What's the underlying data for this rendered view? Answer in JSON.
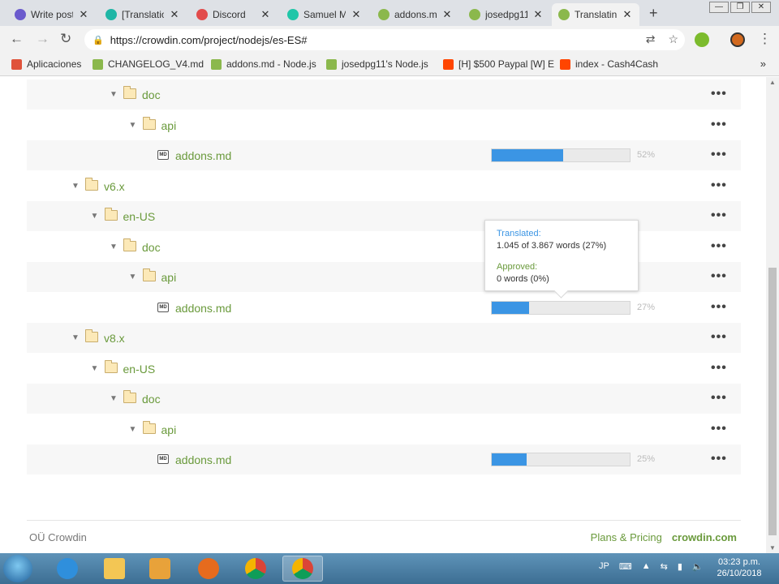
{
  "browser": {
    "tabs": [
      {
        "title": "Write post",
        "color": "#6a5acd"
      },
      {
        "title": "[Translatio",
        "color": "#1fb6a6"
      },
      {
        "title": "Discord",
        "color": "#e24b4b"
      },
      {
        "title": "Samuel M",
        "color": "#1fc6a8"
      },
      {
        "title": "addons.m",
        "color": "#8bb84c"
      },
      {
        "title": "josedpg11",
        "color": "#8bb84c"
      },
      {
        "title": "Translatin",
        "color": "#8bb84c"
      }
    ],
    "close_glyph": "✕",
    "new_tab": "+",
    "url": "https://crowdin.com/project/nodejs/es-ES#",
    "window_controls": [
      "—",
      "❐",
      "✕"
    ]
  },
  "bookmarks": [
    {
      "label": "Aplicaciones",
      "color": "#e0533b"
    },
    {
      "label": "CHANGELOG_V4.md",
      "color": "#8bb84c"
    },
    {
      "label": "addons.md - Node.js",
      "color": "#8bb84c"
    },
    {
      "label": "josedpg11's Node.js",
      "color": "#8bb84c"
    },
    {
      "label": "[H] $500 Paypal [W] E",
      "color": "#ff4500"
    },
    {
      "label": "index - Cash4Cash",
      "color": "#ff4500"
    }
  ],
  "tree": [
    {
      "label": "doc",
      "type": "folder",
      "level": 2
    },
    {
      "label": "api",
      "type": "folder",
      "level": 3
    },
    {
      "label": "addons.md",
      "type": "file",
      "level": 4,
      "progress": 52,
      "pct_label": "52%"
    },
    {
      "label": "v6.x",
      "type": "folder",
      "level": 0
    },
    {
      "label": "en-US",
      "type": "folder",
      "level": 1
    },
    {
      "label": "doc",
      "type": "folder",
      "level": 2
    },
    {
      "label": "api",
      "type": "folder",
      "level": 3
    },
    {
      "label": "addons.md",
      "type": "file",
      "level": 4,
      "progress": 27,
      "pct_label": "27%"
    },
    {
      "label": "v8.x",
      "type": "folder",
      "level": 0
    },
    {
      "label": "en-US",
      "type": "folder",
      "level": 1
    },
    {
      "label": "doc",
      "type": "folder",
      "level": 2
    },
    {
      "label": "api",
      "type": "folder",
      "level": 3
    },
    {
      "label": "addons.md",
      "type": "file",
      "level": 4,
      "progress": 25,
      "pct_label": "25%"
    }
  ],
  "file_icon_text": "MD",
  "more_glyph": "•••",
  "tooltip": {
    "translated_label": "Translated:",
    "translated_value": "1.045 of 3.867 words (27%)",
    "approved_label": "Approved:",
    "approved_value": "0 words (0%)"
  },
  "footer": {
    "company": "OÜ Crowdin",
    "plans": "Plans & Pricing",
    "brand": "crowdin.com"
  },
  "taskbar": {
    "lang": "JP",
    "time": "03:23 p.m.",
    "date": "26/10/2018"
  }
}
